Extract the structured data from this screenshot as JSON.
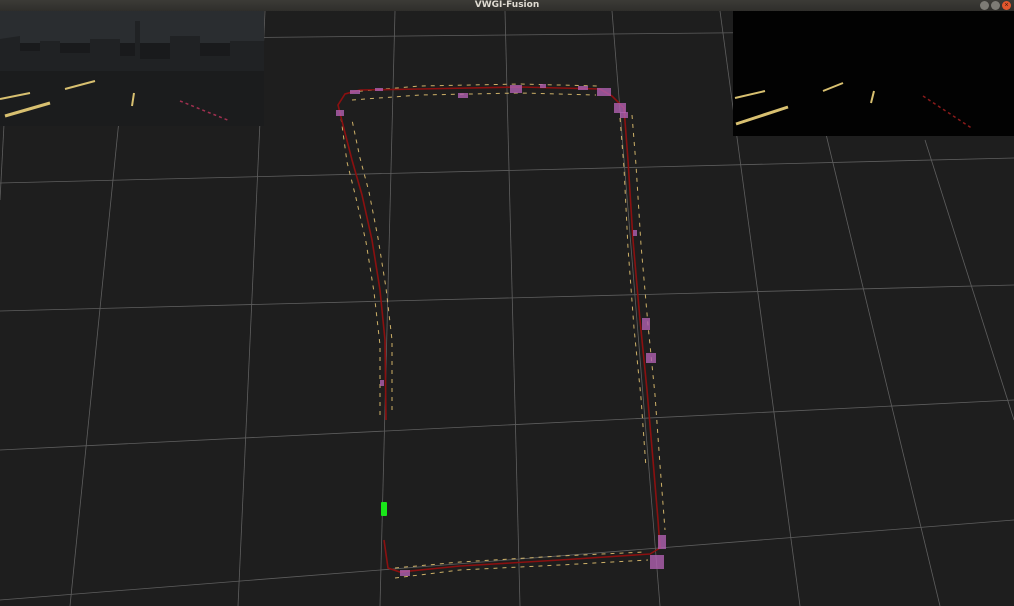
{
  "window": {
    "title": "VWGI-Fusion"
  },
  "colors": {
    "background": "#1e1e1e",
    "grid": "#6f6f6f",
    "trajectory": "#8b1010",
    "lane_marks": "#e0c070",
    "features": "#b060b0",
    "vehicle": "#19e619"
  },
  "icons": {
    "minimize": "minimize-icon",
    "maximize": "maximize-icon",
    "close": "close-icon"
  }
}
